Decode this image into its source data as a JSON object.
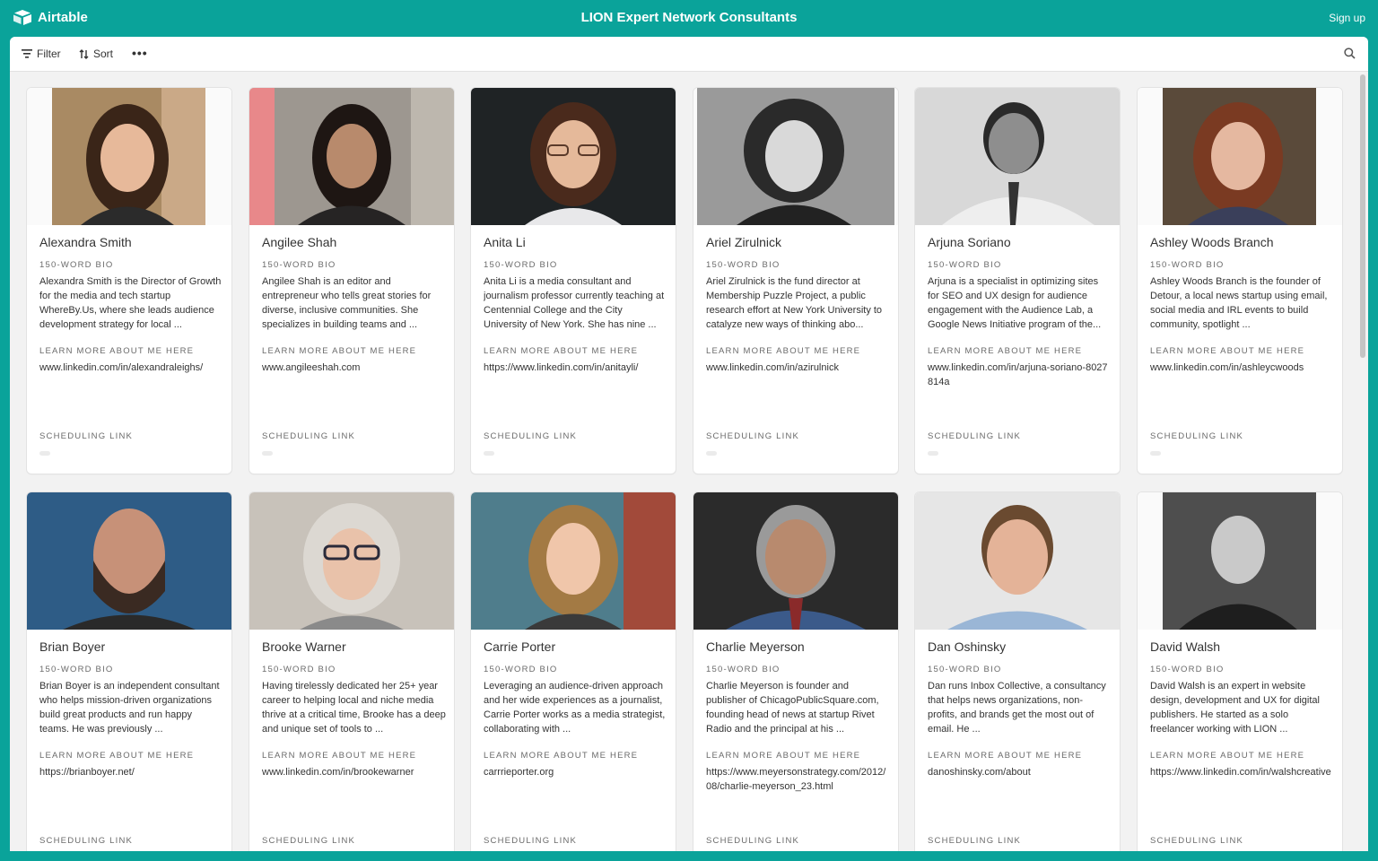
{
  "app": {
    "brand": "Airtable",
    "title": "LION Expert Network Consultants",
    "signup": "Sign up"
  },
  "toolbar": {
    "filter": "Filter",
    "sort": "Sort",
    "more": "•••"
  },
  "colors": {
    "header_teal": "#0aa39a",
    "panel_bg": "#f2f2f2",
    "card_bg": "#ffffff"
  },
  "labels": {
    "bio": "150-WORD BIO",
    "learn": "LEARN MORE ABOUT ME HERE",
    "sched": "SCHEDULING LINK"
  },
  "cards": [
    {
      "name": "Alexandra Smith",
      "bio": "Alexandra Smith is the Director of Growth for the media and tech startup WhereBy.Us, where she leads audience development strategy for local ...",
      "link": "www.linkedin.com/in/alexandraleighs/"
    },
    {
      "name": "Angilee Shah",
      "bio": "Angilee Shah is an editor and entrepreneur who tells great stories for diverse, inclusive communities. She specializes in building teams and ...",
      "link": "www.angileeshah.com"
    },
    {
      "name": "Anita Li",
      "bio": "Anita Li is a media consultant and journalism professor currently teaching at Centennial College and the City University of New York. She has nine ...",
      "link": "https://www.linkedin.com/in/anitayli/"
    },
    {
      "name": "Ariel Zirulnick",
      "bio": "Ariel Zirulnick is the fund director at Membership Puzzle Project, a public research effort at New York University to catalyze new ways of thinking abo...",
      "link": "www.linkedin.com/in/azirulnick"
    },
    {
      "name": "Arjuna Soriano",
      "bio": "Arjuna is a specialist in optimizing sites for SEO and UX design for audience engagement with the Audience Lab, a Google News Initiative program of the...",
      "link": "www.linkedin.com/in/arjuna-soriano-8027814a"
    },
    {
      "name": "Ashley Woods Branch",
      "bio": "Ashley Woods Branch is the founder of Detour, a local news startup using email, social media and IRL events to build community, spotlight ...",
      "link": "www.linkedin.com/in/ashleycwoods"
    },
    {
      "name": "Brian Boyer",
      "bio": "Brian Boyer is an independent consultant who helps mission-driven organizations build great products and run happy teams. He was previously ...",
      "link": "https://brianboyer.net/"
    },
    {
      "name": "Brooke Warner",
      "bio": "Having tirelessly dedicated her 25+ year career to helping local and niche media thrive at a critical time, Brooke has a deep and unique set of tools to ...",
      "link": "www.linkedin.com/in/brookewarner"
    },
    {
      "name": "Carrie Porter",
      "bio": "Leveraging an audience-driven approach and her wide experiences as a journalist, Carrie Porter works as a media strategist, collaborating with ...",
      "link": "carrrieporter.org"
    },
    {
      "name": "Charlie Meyerson",
      "bio": "Charlie Meyerson is founder and publisher of ChicagoPublicSquare.com, founding head of news at startup Rivet Radio and the principal at his ...",
      "link": "https://www.meyersonstrategy.com/2012/08/charlie-meyerson_23.html"
    },
    {
      "name": "Dan Oshinsky",
      "bio": "Dan runs Inbox Collective, a consultancy that helps news organizations, non-profits, and brands get the most out of email. He ...",
      "link": "danoshinsky.com/about"
    },
    {
      "name": "David Walsh",
      "bio": "David Walsh is an expert in website design, development and UX for digital publishers. He started as a solo freelancer working with LION ...",
      "link": "https://www.linkedin.com/in/walshcreative"
    }
  ]
}
